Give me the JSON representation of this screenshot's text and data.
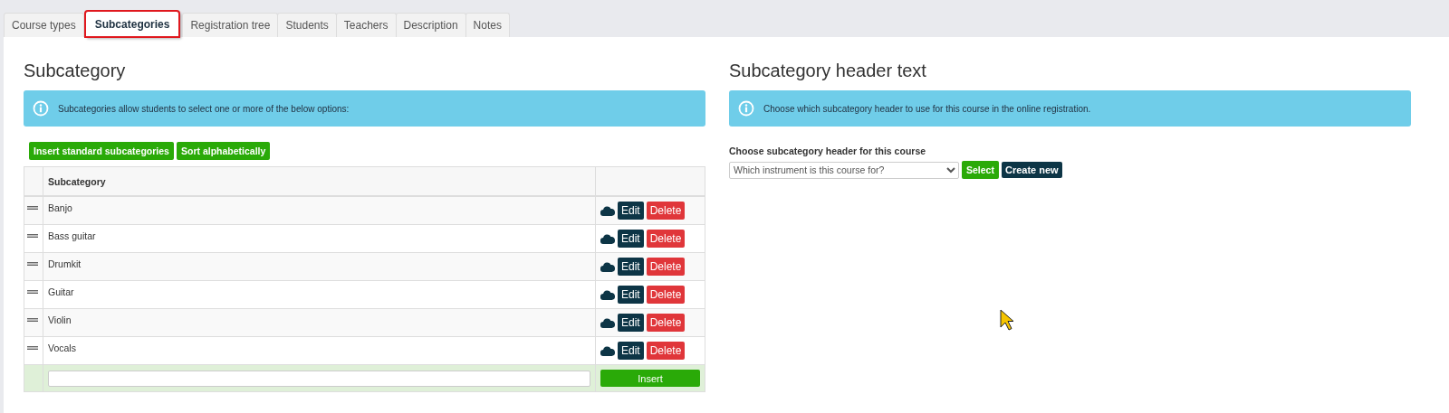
{
  "tabs": [
    {
      "label": "Course types",
      "selected": false
    },
    {
      "label": "Subcategories",
      "selected": true
    },
    {
      "label": "Registration tree",
      "selected": false
    },
    {
      "label": "Students",
      "selected": false
    },
    {
      "label": "Teachers",
      "selected": false
    },
    {
      "label": "Description",
      "selected": false
    },
    {
      "label": "Notes",
      "selected": false
    }
  ],
  "left": {
    "title": "Subcategory",
    "info": "Subcategories allow students to select one or more of the below options:",
    "buttons": [
      "Insert standard subcategories",
      "Sort alphabetically"
    ],
    "table": {
      "columns": [
        "Subcategory"
      ],
      "rows": [
        {
          "name": "Banjo",
          "edit": "Edit",
          "delete": "Delete"
        },
        {
          "name": "Bass guitar",
          "edit": "Edit",
          "delete": "Delete"
        },
        {
          "name": "Drumkit",
          "edit": "Edit",
          "delete": "Delete"
        },
        {
          "name": "Guitar",
          "edit": "Edit",
          "delete": "Delete"
        },
        {
          "name": "Violin",
          "edit": "Edit",
          "delete": "Delete"
        },
        {
          "name": "Vocals",
          "edit": "Edit",
          "delete": "Delete"
        }
      ],
      "insert_button": "Insert"
    }
  },
  "right": {
    "title": "Subcategory header text",
    "info": "Choose which subcategory header to use for this course in the online registration.",
    "label": "Choose subcategory header for this course",
    "select_value": "Which instrument is this course for?",
    "select_button": "Select",
    "create_button": "Create new"
  }
}
